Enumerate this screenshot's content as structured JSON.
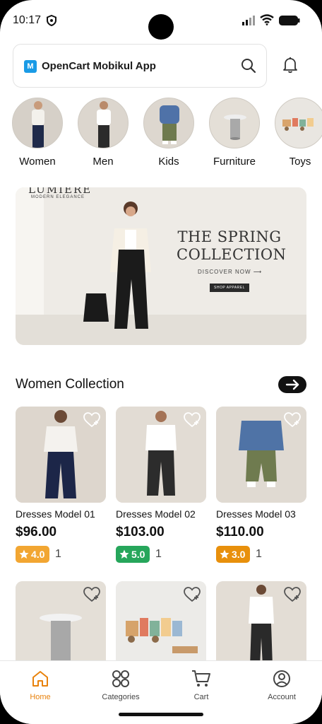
{
  "status_bar": {
    "time": "10:17"
  },
  "header": {
    "app_title": "OpenCart Mobikul App",
    "logo_letter": "M"
  },
  "categories": [
    {
      "label": "Women"
    },
    {
      "label": "Men"
    },
    {
      "label": "Kids"
    },
    {
      "label": "Furniture"
    },
    {
      "label": "Toys"
    }
  ],
  "banner": {
    "brand": "LUMIERE",
    "tagline": "MODERN ELEGANCE",
    "headline": "THE SPRING COLLECTION",
    "discover": "DISCOVER NOW ⟶",
    "shop_button": "SHOP APPAREL"
  },
  "section": {
    "title": "Women Collection"
  },
  "products": [
    {
      "name": "Dresses Model 01",
      "price": "$96.00",
      "rating": "4.0",
      "reviews": "1",
      "badge_color": "#f2a632"
    },
    {
      "name": "Dresses Model 02",
      "price": "$103.00",
      "rating": "5.0",
      "reviews": "1",
      "badge_color": "#26a65b"
    },
    {
      "name": "Dresses Model 03",
      "price": "$110.00",
      "rating": "3.0",
      "reviews": "1",
      "badge_color": "#e8900c"
    }
  ],
  "bottom_nav": [
    {
      "label": "Home",
      "icon": "home-icon",
      "active": true
    },
    {
      "label": "Categories",
      "icon": "grid-icon",
      "active": false
    },
    {
      "label": "Cart",
      "icon": "cart-icon",
      "active": false
    },
    {
      "label": "Account",
      "icon": "account-icon",
      "active": false
    }
  ],
  "colors": {
    "accent": "#e8820c",
    "logo": "#1a9be6"
  }
}
